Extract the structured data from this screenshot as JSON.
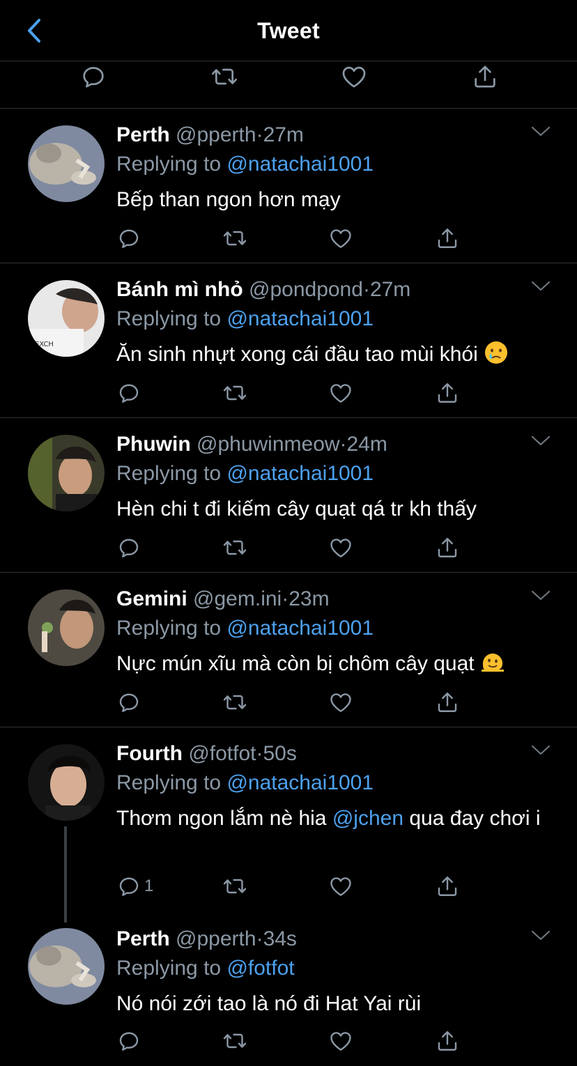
{
  "header": {
    "title": "Tweet"
  },
  "tweets": [
    {
      "name": "Perth",
      "handle": "@pperth",
      "time": "27m",
      "replying_prefix": "Replying to",
      "replying_to": "@natachai1001",
      "text": "Bếp than ngon hơn mạy",
      "reply_count": ""
    },
    {
      "name": "Bánh mì nhỏ",
      "handle": "@pondpond",
      "time": "27m",
      "replying_prefix": "Replying to",
      "replying_to": "@natachai1001",
      "text": "Ăn sinh nhựt xong cái đầu tao mùi khói",
      "emoji": "crying-face-emoji",
      "reply_count": ""
    },
    {
      "name": "Phuwin",
      "handle": "@phuwinmeow",
      "time": "24m",
      "replying_prefix": "Replying to",
      "replying_to": "@natachai1001",
      "text": "Hèn chi t đi kiếm cây quạt qá tr kh thấy",
      "reply_count": ""
    },
    {
      "name": "Gemini",
      "handle": "@gem.ini",
      "time": "23m",
      "replying_prefix": "Replying to",
      "replying_to": "@natachai1001",
      "text": "Nực mún xĩu mà còn bị chôm cây quạt",
      "emoji": "melting-face-emoji",
      "reply_count": ""
    },
    {
      "name": "Fourth",
      "handle": "@fotfot",
      "time": "50s",
      "replying_prefix": "Replying to",
      "replying_to": "@natachai1001",
      "text_before": "Thơm ngon lắm nè hia",
      "text_mention": "@jchen",
      "text_after": "qua đay chơi i",
      "reply_count": "1"
    },
    {
      "name": "Perth",
      "handle": "@pperth",
      "time": "34s",
      "replying_prefix": "Replying to",
      "replying_to": "@fotfot",
      "text": "Nó nói zới tao là nó đi Hat Yai rùi",
      "reply_count": ""
    }
  ],
  "colors": {
    "background": "#000000",
    "accent": "#4da1ee",
    "secondary_text": "#8b98a5",
    "divider": "#2f3336"
  },
  "icons": [
    "back-chevron-icon",
    "reply-icon",
    "retweet-icon",
    "like-icon",
    "share-icon",
    "chevron-down-icon"
  ]
}
